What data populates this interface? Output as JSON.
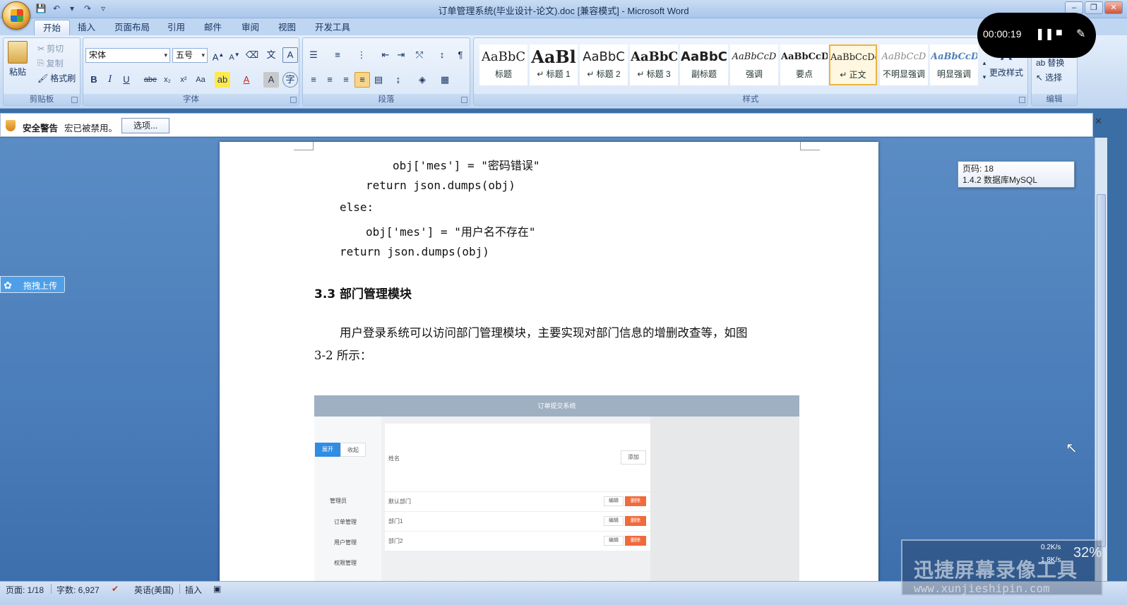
{
  "window": {
    "title": "订单管理系统(毕业设计-论文).doc [兼容模式] - Microsoft Word",
    "controls": [
      "‒",
      "❐",
      "✕"
    ]
  },
  "qat": [
    "💾",
    "↶",
    "▾",
    "↷",
    "▿"
  ],
  "ribbon_tabs": [
    "开始",
    "插入",
    "页面布局",
    "引用",
    "邮件",
    "审阅",
    "视图",
    "开发工具"
  ],
  "clipboard": {
    "label": "剪贴板",
    "paste": "粘贴",
    "cut": "剪切",
    "copy": "复制",
    "format_painter": "格式刷"
  },
  "font_group": {
    "label": "字体",
    "font_name": "宋体",
    "font_size": "五号"
  },
  "paragraph_group": {
    "label": "段落"
  },
  "styles_group": {
    "label": "样式",
    "tiles": [
      {
        "sample": "AaBbC",
        "name": "标题"
      },
      {
        "sample": "AaBl",
        "name": "↵ 标题 1"
      },
      {
        "sample": "AaBbC",
        "name": "↵ 标题 2"
      },
      {
        "sample": "AaBbC",
        "name": "↵ 标题 3"
      },
      {
        "sample": "AaBbC",
        "name": "副标题"
      },
      {
        "sample": "AaBbCcD",
        "name": "强调"
      },
      {
        "sample": "AaBbCcD",
        "name": "要点"
      },
      {
        "sample": "AaBbCcDc",
        "name": "↵ 正文"
      },
      {
        "sample": "AaBbCcD",
        "name": "不明显强调"
      },
      {
        "sample": "AaBbCcD",
        "name": "明显强调"
      }
    ],
    "change_styles": "更改样式"
  },
  "editing_group": {
    "label": "编辑",
    "replace": "替换",
    "select": "选择"
  },
  "security_bar": {
    "title": "安全警告",
    "message": "宏已被禁用。",
    "options_button": "选项..."
  },
  "document": {
    "code_lines": [
      "obj['mes'] = \"密码错误\"",
      "return json.dumps(obj)",
      "else:",
      "obj['mes'] = \"用户名不存在\"",
      "return json.dumps(obj)"
    ],
    "heading": "3.3 部门管理模块",
    "para_line1": "用户登录系统可以访问部门管理模块，主要实现对部门信息的增删改查等，如图",
    "para_line2": "3-2 所示：",
    "figure": {
      "header": "订单提交系统",
      "expand": "展开",
      "collapse": "收起",
      "menu": [
        "管理员",
        "订单管理",
        "用户管理",
        "权限管理"
      ],
      "name_label": "姓名",
      "add_button": "添加",
      "rows": [
        "默认部门",
        "部门1",
        "部门2"
      ],
      "edit": "编辑",
      "delete": "删除"
    }
  },
  "tooltip": {
    "line1": "页码: 18",
    "line2": "1.4.2 数据库MySQL"
  },
  "recorder": {
    "time": "00:00:19"
  },
  "upload": {
    "label": "拖拽上传"
  },
  "statusbar": {
    "page": "页面: 1/18",
    "words": "字数: 6,927",
    "language": "英语(美国)",
    "mode": "插入"
  },
  "watermark": {
    "title": "迅捷屏幕录像工具",
    "url": "www.xunjieshipin.com"
  },
  "netmon": {
    "percent": "32%",
    "up": "0.2K/s",
    "down": "1.8K/s"
  }
}
